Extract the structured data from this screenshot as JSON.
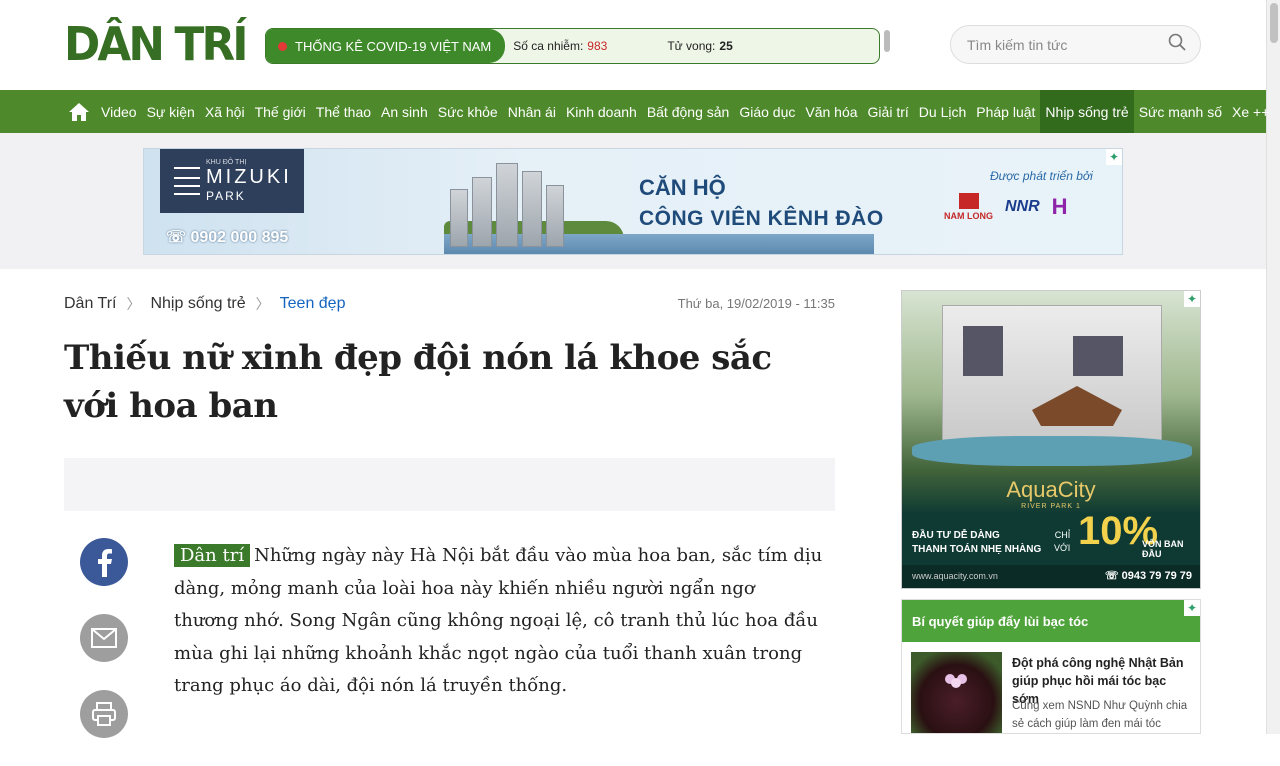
{
  "logo": "DÂN TRÍ",
  "covid": {
    "title": "THỐNG KÊ COVID-19 VIỆT NAM",
    "cases_label": "Số ca nhiễm:",
    "cases_value": "983",
    "deaths_label": "Tử vong:",
    "deaths_value": "25"
  },
  "search": {
    "placeholder": "Tìm kiếm tin tức"
  },
  "nav": {
    "items": [
      "Video",
      "Sự kiện",
      "Xã hội",
      "Thế giới",
      "Thể thao",
      "An sinh",
      "Sức khỏe",
      "Nhân ái",
      "Kinh doanh",
      "Bất động sản",
      "Giáo dục",
      "Văn hóa",
      "Giải trí",
      "Du Lịch",
      "Pháp luật",
      "Nhịp sống trẻ",
      "Sức mạnh số",
      "Xe ++"
    ],
    "active": "Nhịp sống trẻ"
  },
  "banner": {
    "logo_small": "KHU ĐÔ THỊ",
    "logo_big": "MIZUKI",
    "logo_park": "PARK",
    "phone": "0902 000 895",
    "headline1": "CĂN HỘ",
    "headline2": "CÔNG VIÊN KÊNH ĐÀO",
    "dev_label": "Được phát triển bởi",
    "brand1": "NAM LONG",
    "brand2": "NNR",
    "brand3": "H"
  },
  "breadcrumb": [
    "Dân Trí",
    "Nhịp sống trẻ",
    "Teen đẹp"
  ],
  "date": "Thứ ba, 19/02/2019 - 11:35",
  "article": {
    "title": "Thiếu nữ xinh đẹp đội nón lá khoe sắc với hoa ban",
    "tag": "Dân trí",
    "lead": "Những ngày này Hà Nội bắt đầu vào mùa hoa ban, sắc tím dịu dàng, mỏng manh của loài hoa này khiến nhiều người ngẩn ngơ thương nhớ. Song Ngân cũng không ngoại lệ, cô tranh thủ lúc hoa đầu mùa ghi lại những khoảnh khắc ngọt ngào của tuổi thanh xuân trong trang phục áo dài, đội nón lá truyền thống."
  },
  "side_ad": {
    "logo": "AquaCity",
    "sub": "RIVER PARK 1",
    "left_line1": "ĐẦU TƯ DỄ DÀNG",
    "left_line2": "THANH TOÁN NHẸ NHÀNG",
    "chi": "CHỈ",
    "voi": "VỚI",
    "pct": "10%",
    "von": "VỐN BAN ĐẦU",
    "url": "www.aquacity.com.vn",
    "phone": "0943 79 79 79"
  },
  "side_box": {
    "title": "Bí quyết giúp đẩy lùi bạc tóc",
    "headline": "Đột phá công nghệ Nhật Bản giúp phục hồi mái tóc bạc sớm",
    "desc": "Cùng xem NSND Như Quỳnh chia sẻ cách giúp làm đen mái tóc"
  },
  "colors": {
    "brand_green": "#4e8a2b",
    "dark_green": "#366e23",
    "link_blue": "#1565c0"
  }
}
